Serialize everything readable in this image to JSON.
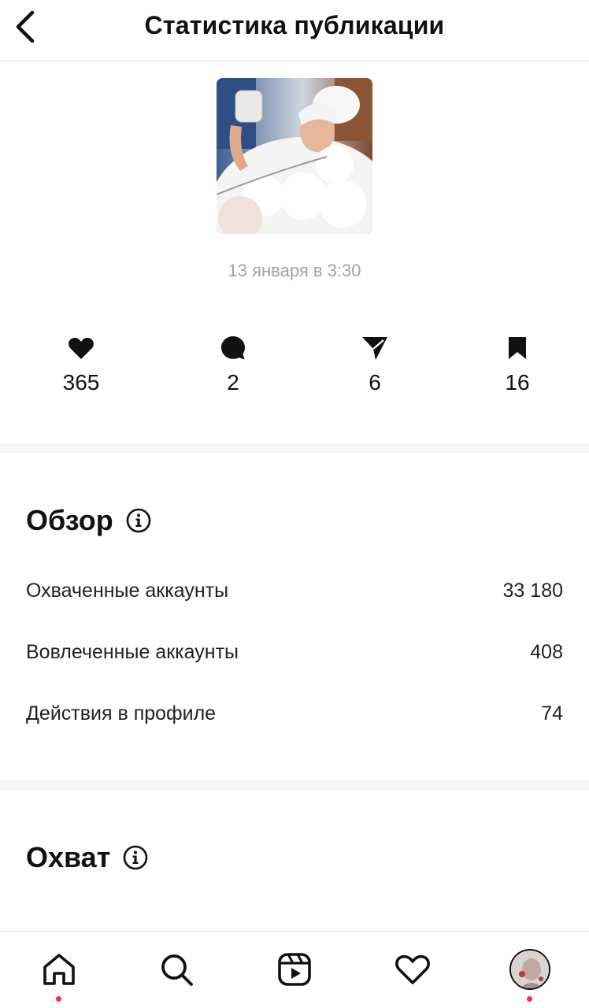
{
  "header": {
    "title": "Статистика публикации"
  },
  "post": {
    "date": "13 января в 3:30",
    "thumbnail": "photo of woman in bathtub with foam holding a mug"
  },
  "interactions": {
    "likes": "365",
    "comments": "2",
    "shares": "6",
    "saves": "16"
  },
  "overview": {
    "title": "Обзор",
    "rows": [
      {
        "label": "Охваченные аккаунты",
        "value": "33 180"
      },
      {
        "label": "Вовлеченные аккаунты",
        "value": "408"
      },
      {
        "label": "Действия в профиле",
        "value": "74"
      }
    ]
  },
  "reach": {
    "title": "Охват"
  },
  "icons": {
    "back": "chevron-left-icon",
    "like": "heart-icon",
    "comment": "comment-bubble-icon",
    "share": "paper-plane-icon",
    "save": "bookmark-icon",
    "info": "info-icon",
    "nav": [
      "home-icon",
      "search-icon",
      "reels-icon",
      "heart-icon",
      "avatar"
    ]
  },
  "colors": {
    "notification_dot": "#ed2f4f",
    "date_text": "#a3a3a3",
    "divider": "#f6f6f6"
  }
}
